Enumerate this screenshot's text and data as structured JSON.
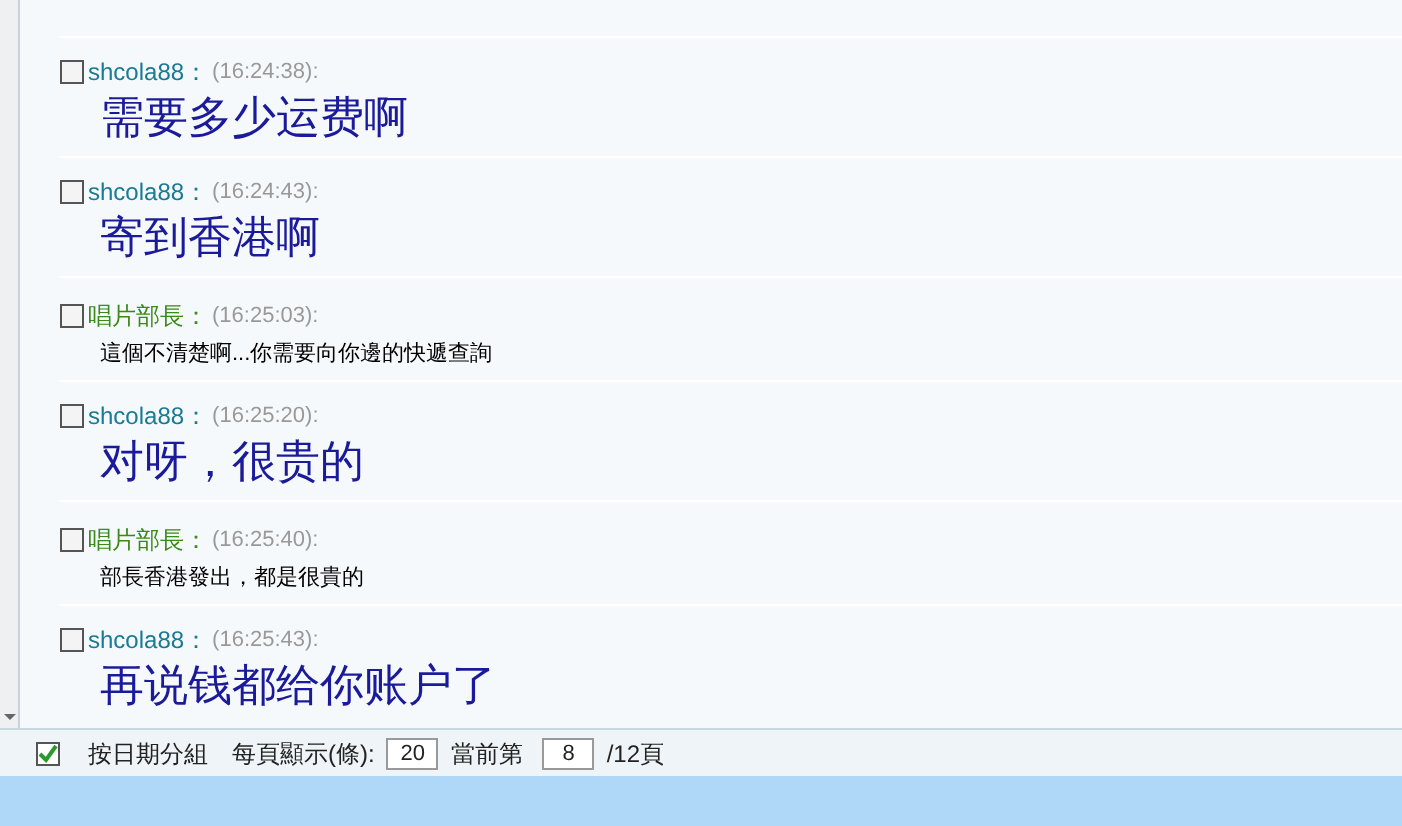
{
  "messages": [
    {
      "sender": "shcola88：",
      "color": "#1a7a96",
      "time": "(16:24:38):",
      "text": "需要多少运费啊",
      "kind": "large",
      "checked": false
    },
    {
      "sender": "shcola88：",
      "color": "#1a7a96",
      "time": "(16:24:43):",
      "text": "寄到香港啊",
      "kind": "large",
      "checked": false
    },
    {
      "sender": "唱片部長：",
      "color": "#3a8a1a",
      "time": "(16:25:03):",
      "text": "這個不清楚啊...你需要向你邊的快遞查詢",
      "kind": "small",
      "checked": false
    },
    {
      "sender": "shcola88：",
      "color": "#1a7a96",
      "time": "(16:25:20):",
      "text": "对呀，很贵的",
      "kind": "large",
      "checked": false
    },
    {
      "sender": "唱片部長：",
      "color": "#3a8a1a",
      "time": "(16:25:40):",
      "text": "部長香港發出，都是很貴的",
      "kind": "small",
      "checked": false
    },
    {
      "sender": "shcola88：",
      "color": "#1a7a96",
      "time": "(16:25:43):",
      "text": "再说钱都给你账户了",
      "kind": "large",
      "checked": false
    }
  ],
  "footer": {
    "group_by_date": {
      "label": "按日期分組",
      "checked": true
    },
    "per_page_label": "每頁顯示(條):",
    "per_page": "20",
    "current_label": "當前第",
    "current_page": "8",
    "total": "/12頁"
  }
}
